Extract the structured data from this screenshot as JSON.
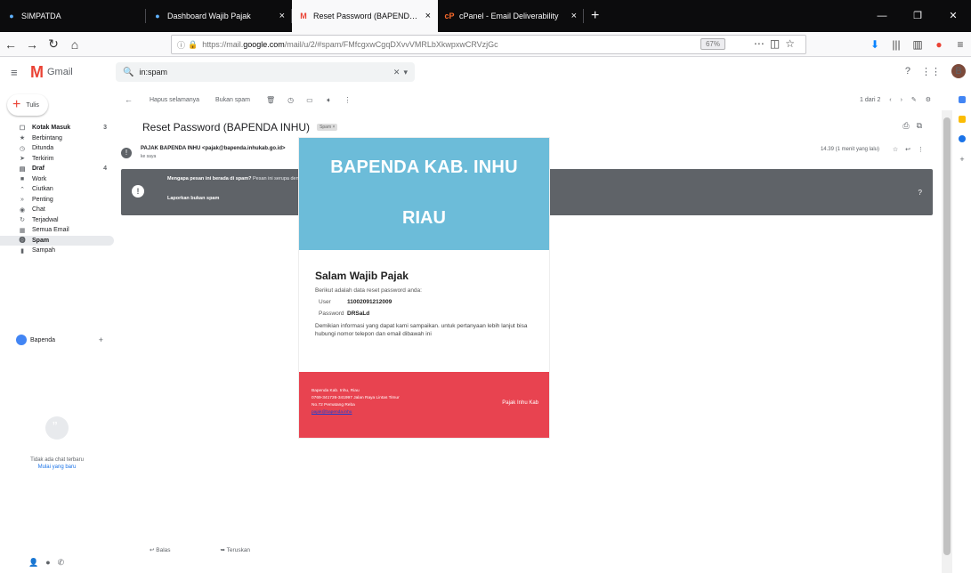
{
  "browser": {
    "tabs": [
      {
        "title": "SIMPATDA",
        "fav": "●",
        "active": false
      },
      {
        "title": "Dashboard Wajib Pajak",
        "fav": "●",
        "active": false
      },
      {
        "title": "Reset Password (BAPENDA IN",
        "fav": "M",
        "active": true
      },
      {
        "title": "cPanel - Email Deliverability",
        "fav": "cP",
        "active": false
      }
    ],
    "url_prefix": "https://mail.",
    "url_host": "google.com",
    "url_path": "/mail/u/2/#spam/FMfcgxwCgqDXvvVMRLbXkwpxwCRVzjGc",
    "zoom": "67%"
  },
  "gmail": {
    "logo_text": "Gmail",
    "search_value": "in:spam",
    "avatar_letter": "B",
    "compose_label": "Tulis",
    "nav": [
      {
        "label": "Kotak Masuk",
        "icon": "☐",
        "bold": true,
        "extra": "3"
      },
      {
        "label": "Berbintang",
        "icon": "★",
        "bold": false,
        "extra": ""
      },
      {
        "label": "Ditunda",
        "icon": "◷",
        "bold": false,
        "extra": ""
      },
      {
        "label": "Terkirim",
        "icon": "➤",
        "bold": false,
        "extra": ""
      },
      {
        "label": "Draf",
        "icon": "▤",
        "bold": true,
        "extra": "4"
      },
      {
        "label": "Work",
        "icon": "■",
        "bold": false,
        "extra": ""
      },
      {
        "label": "Ciutkan",
        "icon": "⌃",
        "bold": false,
        "extra": ""
      },
      {
        "label": "Penting",
        "icon": "»",
        "bold": false,
        "extra": ""
      },
      {
        "label": "Chat",
        "icon": "◉",
        "bold": false,
        "extra": ""
      },
      {
        "label": "Terjadwal",
        "icon": "↻",
        "bold": false,
        "extra": ""
      },
      {
        "label": "Semua Email",
        "icon": "▦",
        "bold": false,
        "extra": ""
      },
      {
        "label": "Spam",
        "icon": "⓿",
        "bold": true,
        "extra": "",
        "active": true
      },
      {
        "label": "Sampah",
        "icon": "▮",
        "bold": false,
        "extra": ""
      }
    ],
    "chat_user": "Bapenda",
    "no_chat_line1": "Tidak ada chat terbaru",
    "no_chat_line2": "Mulai yang baru"
  },
  "toolbar": {
    "back_label": "Hapus selamanya",
    "not_spam_label": "Bukan spam",
    "pager": "1 dari 2"
  },
  "message": {
    "subject": "Reset Password (BAPENDA INHU)",
    "tag": "Spam ×",
    "from": "PAJAK BAPENDA INHU <pajak@bapenda.inhukab.go.id>",
    "to": "ke saya",
    "time": "14.39 (1 menit yang lalu)",
    "spam_bold": "Mengapa pesan ini berada di spam?",
    "spam_rest": " Pesan ini serupa dengan pesan yang diidentifikasi sebagai spam di masa lalu.",
    "spam_link": "Laporkan bukan spam"
  },
  "email": {
    "head_line1": "BAPENDA KAB. INHU",
    "head_line2": "RIAU",
    "greeting": "Salam Wajib Pajak",
    "intro": "Berikut adalah data reset password anda:",
    "user_label": "User",
    "user_value": "11002091212009",
    "password_label": "Password",
    "password_value": "DRSaLd",
    "closing": "Demikian informasi yang dapat kami sampaikan. untuk pertanyaan lebih lanjut bisa hubungi nomor telepon dan email dibawah ini",
    "foot_line1": "Bapenda Kab. Inhu, Riau",
    "foot_line2": "0769-341726-341997 Jalan Raya Lintas Timur",
    "foot_line3": "No.72 Pematang Reba",
    "foot_email": "pajak@bapenda.inhu",
    "foot_brand": "Pajak Inhu Kab"
  },
  "reply": {
    "reply_label": "Balas",
    "forward_label": "Teruskan"
  }
}
